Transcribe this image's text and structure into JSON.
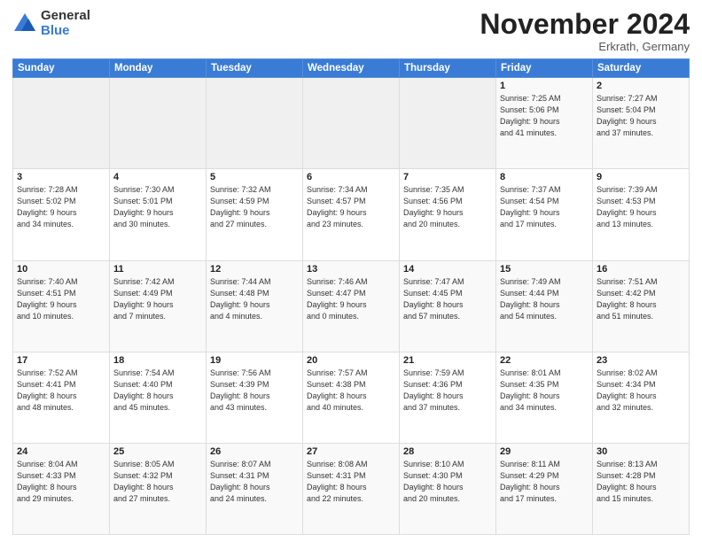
{
  "header": {
    "logo_general": "General",
    "logo_blue": "Blue",
    "month_title": "November 2024",
    "subtitle": "Erkrath, Germany"
  },
  "days_of_week": [
    "Sunday",
    "Monday",
    "Tuesday",
    "Wednesday",
    "Thursday",
    "Friday",
    "Saturday"
  ],
  "weeks": [
    [
      {
        "day": "",
        "info": ""
      },
      {
        "day": "",
        "info": ""
      },
      {
        "day": "",
        "info": ""
      },
      {
        "day": "",
        "info": ""
      },
      {
        "day": "",
        "info": ""
      },
      {
        "day": "1",
        "info": "Sunrise: 7:25 AM\nSunset: 5:06 PM\nDaylight: 9 hours\nand 41 minutes."
      },
      {
        "day": "2",
        "info": "Sunrise: 7:27 AM\nSunset: 5:04 PM\nDaylight: 9 hours\nand 37 minutes."
      }
    ],
    [
      {
        "day": "3",
        "info": "Sunrise: 7:28 AM\nSunset: 5:02 PM\nDaylight: 9 hours\nand 34 minutes."
      },
      {
        "day": "4",
        "info": "Sunrise: 7:30 AM\nSunset: 5:01 PM\nDaylight: 9 hours\nand 30 minutes."
      },
      {
        "day": "5",
        "info": "Sunrise: 7:32 AM\nSunset: 4:59 PM\nDaylight: 9 hours\nand 27 minutes."
      },
      {
        "day": "6",
        "info": "Sunrise: 7:34 AM\nSunset: 4:57 PM\nDaylight: 9 hours\nand 23 minutes."
      },
      {
        "day": "7",
        "info": "Sunrise: 7:35 AM\nSunset: 4:56 PM\nDaylight: 9 hours\nand 20 minutes."
      },
      {
        "day": "8",
        "info": "Sunrise: 7:37 AM\nSunset: 4:54 PM\nDaylight: 9 hours\nand 17 minutes."
      },
      {
        "day": "9",
        "info": "Sunrise: 7:39 AM\nSunset: 4:53 PM\nDaylight: 9 hours\nand 13 minutes."
      }
    ],
    [
      {
        "day": "10",
        "info": "Sunrise: 7:40 AM\nSunset: 4:51 PM\nDaylight: 9 hours\nand 10 minutes."
      },
      {
        "day": "11",
        "info": "Sunrise: 7:42 AM\nSunset: 4:49 PM\nDaylight: 9 hours\nand 7 minutes."
      },
      {
        "day": "12",
        "info": "Sunrise: 7:44 AM\nSunset: 4:48 PM\nDaylight: 9 hours\nand 4 minutes."
      },
      {
        "day": "13",
        "info": "Sunrise: 7:46 AM\nSunset: 4:47 PM\nDaylight: 9 hours\nand 0 minutes."
      },
      {
        "day": "14",
        "info": "Sunrise: 7:47 AM\nSunset: 4:45 PM\nDaylight: 8 hours\nand 57 minutes."
      },
      {
        "day": "15",
        "info": "Sunrise: 7:49 AM\nSunset: 4:44 PM\nDaylight: 8 hours\nand 54 minutes."
      },
      {
        "day": "16",
        "info": "Sunrise: 7:51 AM\nSunset: 4:42 PM\nDaylight: 8 hours\nand 51 minutes."
      }
    ],
    [
      {
        "day": "17",
        "info": "Sunrise: 7:52 AM\nSunset: 4:41 PM\nDaylight: 8 hours\nand 48 minutes."
      },
      {
        "day": "18",
        "info": "Sunrise: 7:54 AM\nSunset: 4:40 PM\nDaylight: 8 hours\nand 45 minutes."
      },
      {
        "day": "19",
        "info": "Sunrise: 7:56 AM\nSunset: 4:39 PM\nDaylight: 8 hours\nand 43 minutes."
      },
      {
        "day": "20",
        "info": "Sunrise: 7:57 AM\nSunset: 4:38 PM\nDaylight: 8 hours\nand 40 minutes."
      },
      {
        "day": "21",
        "info": "Sunrise: 7:59 AM\nSunset: 4:36 PM\nDaylight: 8 hours\nand 37 minutes."
      },
      {
        "day": "22",
        "info": "Sunrise: 8:01 AM\nSunset: 4:35 PM\nDaylight: 8 hours\nand 34 minutes."
      },
      {
        "day": "23",
        "info": "Sunrise: 8:02 AM\nSunset: 4:34 PM\nDaylight: 8 hours\nand 32 minutes."
      }
    ],
    [
      {
        "day": "24",
        "info": "Sunrise: 8:04 AM\nSunset: 4:33 PM\nDaylight: 8 hours\nand 29 minutes."
      },
      {
        "day": "25",
        "info": "Sunrise: 8:05 AM\nSunset: 4:32 PM\nDaylight: 8 hours\nand 27 minutes."
      },
      {
        "day": "26",
        "info": "Sunrise: 8:07 AM\nSunset: 4:31 PM\nDaylight: 8 hours\nand 24 minutes."
      },
      {
        "day": "27",
        "info": "Sunrise: 8:08 AM\nSunset: 4:31 PM\nDaylight: 8 hours\nand 22 minutes."
      },
      {
        "day": "28",
        "info": "Sunrise: 8:10 AM\nSunset: 4:30 PM\nDaylight: 8 hours\nand 20 minutes."
      },
      {
        "day": "29",
        "info": "Sunrise: 8:11 AM\nSunset: 4:29 PM\nDaylight: 8 hours\nand 17 minutes."
      },
      {
        "day": "30",
        "info": "Sunrise: 8:13 AM\nSunset: 4:28 PM\nDaylight: 8 hours\nand 15 minutes."
      }
    ]
  ]
}
